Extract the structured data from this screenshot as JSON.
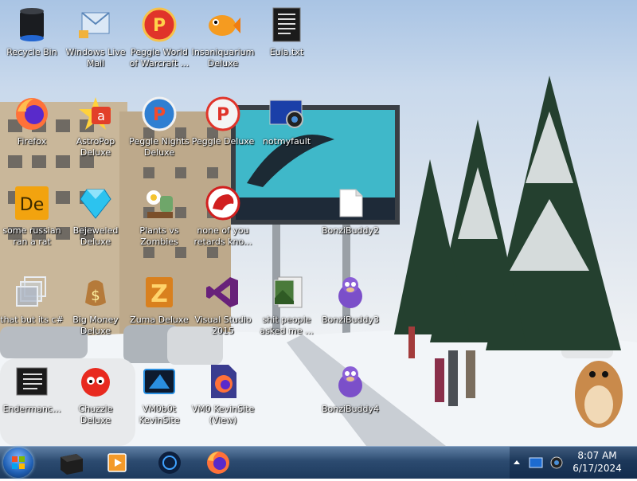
{
  "desktop": {
    "icons": [
      {
        "label": "Recycle Bin",
        "icon": "recycle-bin-icon"
      },
      {
        "label": "Windows Live Mail",
        "icon": "windows-live-mail-icon"
      },
      {
        "label": "Peggle World of Warcraft ...",
        "icon": "peggle-wow-icon"
      },
      {
        "label": "Insaniquarium Deluxe",
        "icon": "insaniquarium-icon"
      },
      {
        "label": "Eula.txt",
        "icon": "text-file-icon"
      },
      {
        "label": "Firefox",
        "icon": "firefox-icon"
      },
      {
        "label": "AstroPop Deluxe",
        "icon": "astropop-icon"
      },
      {
        "label": "Peggle Nights Deluxe",
        "icon": "peggle-nights-icon"
      },
      {
        "label": "Peggle Deluxe",
        "icon": "peggle-deluxe-icon"
      },
      {
        "label": "notmyfault",
        "icon": "notmyfault-icon"
      },
      {
        "label": "some russian ran a rat",
        "icon": "de-app-icon"
      },
      {
        "label": "Bejeweled Deluxe",
        "icon": "bejeweled-icon"
      },
      {
        "label": "Plants vs Zombies",
        "icon": "plants-vs-zombies-icon"
      },
      {
        "label": "none of you retards kno...",
        "icon": "red-app-icon"
      },
      {
        "label": "BonziBuddy2",
        "icon": "white-file-icon"
      },
      {
        "label": "that but its c#",
        "icon": "windows-stack-icon"
      },
      {
        "label": "Big Money Deluxe",
        "icon": "big-money-icon"
      },
      {
        "label": "Zuma Deluxe",
        "icon": "zuma-icon"
      },
      {
        "label": "Visual Studio 2015",
        "icon": "visual-studio-icon"
      },
      {
        "label": "shit people asked me ...",
        "icon": "picture-file-icon"
      },
      {
        "label": "BonziBuddy3",
        "icon": "bonzibuddy-icon"
      },
      {
        "label": "Endermanc...",
        "icon": "text-file-icon"
      },
      {
        "label": "Chuzzle Deluxe",
        "icon": "chuzzle-icon"
      },
      {
        "label": "VM0b0t KevinSite",
        "icon": "vm0b0t-icon"
      },
      {
        "label": "VM0 KevinSite (View)",
        "icon": "firefox-file-icon"
      },
      {
        "label": "BonziBuddy4",
        "icon": "bonzibuddy-icon"
      }
    ]
  },
  "taskbar": {
    "pinned": [
      {
        "icon": "terminal-icon"
      },
      {
        "icon": "media-player-icon"
      },
      {
        "icon": "vm-icon"
      },
      {
        "icon": "firefox-icon"
      }
    ],
    "clock": {
      "time": "8:07 AM",
      "date": "6/17/2024"
    }
  }
}
